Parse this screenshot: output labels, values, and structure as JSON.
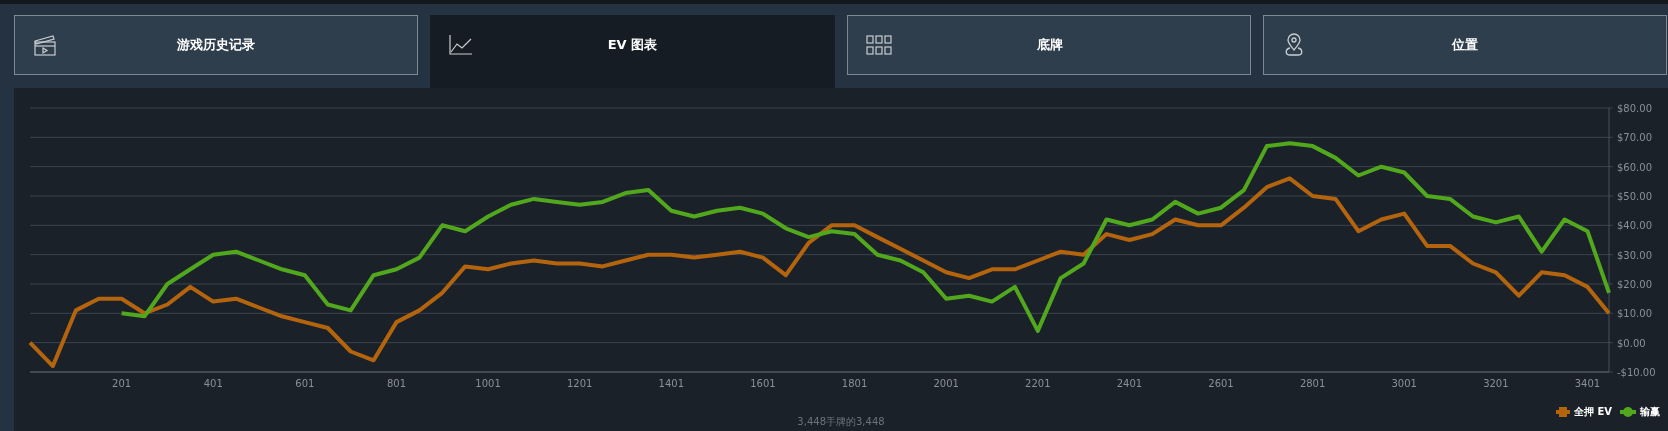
{
  "tabs": [
    {
      "label": "游戏历史记录",
      "selected": false
    },
    {
      "label": "EV 图表",
      "selected": true
    },
    {
      "label": "底牌",
      "selected": false
    },
    {
      "label": "位置",
      "selected": false
    }
  ],
  "chart": {
    "chart_data": {
      "type": "line",
      "x": [
        1,
        51,
        101,
        151,
        201,
        251,
        301,
        351,
        401,
        451,
        501,
        551,
        601,
        651,
        701,
        751,
        801,
        851,
        901,
        951,
        1001,
        1051,
        1101,
        1151,
        1201,
        1251,
        1301,
        1351,
        1401,
        1451,
        1501,
        1551,
        1601,
        1651,
        1701,
        1751,
        1801,
        1851,
        1901,
        1951,
        2001,
        2051,
        2101,
        2151,
        2201,
        2251,
        2301,
        2351,
        2401,
        2451,
        2501,
        2551,
        2601,
        2651,
        2701,
        2751,
        2801,
        2851,
        2901,
        2951,
        3001,
        3051,
        3101,
        3151,
        3201,
        3251,
        3301,
        3351,
        3401,
        3448
      ],
      "series": [
        {
          "name": "全押 EV",
          "color": "#b5640e",
          "values": [
            0,
            -8,
            11,
            15,
            15,
            10,
            13,
            19,
            14,
            15,
            12,
            9,
            7,
            5,
            -3,
            -6,
            7,
            11,
            17,
            26,
            25,
            27,
            28,
            27,
            27,
            26,
            28,
            30,
            30,
            29,
            30,
            31,
            29,
            23,
            34,
            40,
            40,
            36,
            32,
            28,
            24,
            22,
            25,
            25,
            28,
            31,
            30,
            37,
            35,
            37,
            42,
            40,
            40,
            46,
            53,
            56,
            50,
            49,
            38,
            42,
            44,
            33,
            33,
            27,
            24,
            16,
            24,
            23,
            19,
            10
          ]
        },
        {
          "name": "输赢",
          "color": "#52a81c",
          "values": [
            null,
            null,
            null,
            null,
            10,
            9,
            20,
            25,
            30,
            31,
            28,
            25,
            23,
            13,
            11,
            23,
            25,
            29,
            40,
            38,
            43,
            47,
            49,
            48,
            47,
            48,
            51,
            52,
            45,
            43,
            45,
            46,
            44,
            39,
            36,
            38,
            37,
            30,
            28,
            24,
            15,
            16,
            14,
            19,
            4,
            22,
            27,
            42,
            40,
            42,
            48,
            44,
            46,
            52,
            67,
            68,
            67,
            63,
            57,
            60,
            58,
            50,
            49,
            43,
            41,
            43,
            31,
            42,
            38,
            17
          ]
        }
      ],
      "grid": true,
      "xlim": [
        1,
        3448
      ],
      "ylim": [
        -10,
        80
      ],
      "xticks": [
        201,
        401,
        601,
        801,
        1001,
        1201,
        1401,
        1601,
        1801,
        2001,
        2201,
        2401,
        2601,
        2801,
        3001,
        3201,
        3401
      ],
      "yticks": [
        {
          "value": 80,
          "label": "$80.00"
        },
        {
          "value": 70,
          "label": "$70.00"
        },
        {
          "value": 60,
          "label": "$60.00"
        },
        {
          "value": 50,
          "label": "$50.00"
        },
        {
          "value": 40,
          "label": "$40.00"
        },
        {
          "value": 30,
          "label": "$30.00"
        },
        {
          "value": 20,
          "label": "$20.00"
        },
        {
          "value": 10,
          "label": "$10.00"
        },
        {
          "value": 0,
          "label": "$0.00"
        },
        {
          "value": -10,
          "label": "-$10.00"
        }
      ]
    },
    "caption": "3,448手牌的3,448"
  }
}
